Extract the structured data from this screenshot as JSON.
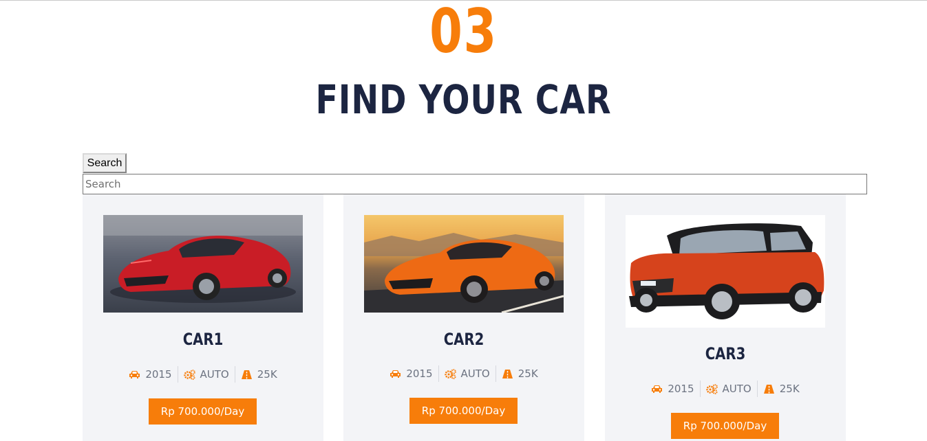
{
  "section": {
    "number": "03",
    "title": "FIND YOUR CAR"
  },
  "search": {
    "button_label": "Search",
    "placeholder": "Search",
    "value": ""
  },
  "cars": [
    {
      "name": "CAR1",
      "year": "2015",
      "transmission": "AUTO",
      "mileage": "25K",
      "price": "Rp 700.000/Day",
      "color": "#d7222c"
    },
    {
      "name": "CAR2",
      "year": "2015",
      "transmission": "AUTO",
      "mileage": "25K",
      "price": "Rp 700.000/Day",
      "color": "#ee6a14"
    },
    {
      "name": "CAR3",
      "year": "2015",
      "transmission": "AUTO",
      "mileage": "25K",
      "price": "Rp 700.000/Day",
      "color": "#d6431c"
    }
  ],
  "icons": {
    "year": "car-icon",
    "transmission": "gears-icon",
    "mileage": "road-icon"
  },
  "colors": {
    "accent": "#f77d0a",
    "heading": "#1c2541",
    "card_bg": "#f3f4f7",
    "muted_text": "#6b7280"
  }
}
